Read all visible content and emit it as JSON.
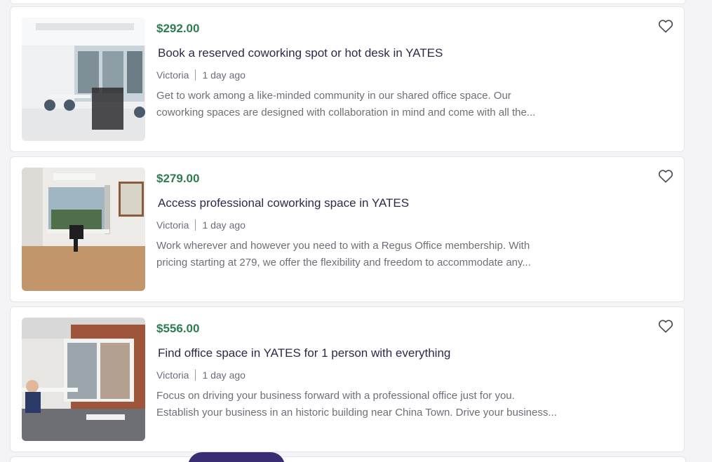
{
  "listings": [
    {
      "price": "$292.00",
      "title": "Book a reserved coworking spot or hot desk in YATES",
      "location": "Victoria",
      "posted": "1 day ago",
      "description_line1": "Get to work among a like-minded community in our shared office space. Our",
      "description_line2": "coworking spaces are designed with collaboration in mind and come with all the..."
    },
    {
      "price": "$279.00",
      "title": "Access professional coworking space in YATES",
      "location": "Victoria",
      "posted": "1 day ago",
      "description_line1": "Work wherever and however you need to with a Regus Office membership. With",
      "description_line2": "pricing starting at 279, we offer the flexibility and freedom to accommodate any..."
    },
    {
      "price": "$556.00",
      "title": "Find office space in YATES for 1 person with everything",
      "location": "Victoria",
      "posted": "1 day ago",
      "description_line1": "Focus on driving your business forward with a professional office just for you.",
      "description_line2": "Establish your business in an historic building near China Town. Drive your business..."
    }
  ],
  "icons": {
    "favorite": "heart-outline-icon"
  },
  "colors": {
    "price": "#2e7d4f",
    "title": "#2c2a4a",
    "fab": "#3a2d73"
  }
}
